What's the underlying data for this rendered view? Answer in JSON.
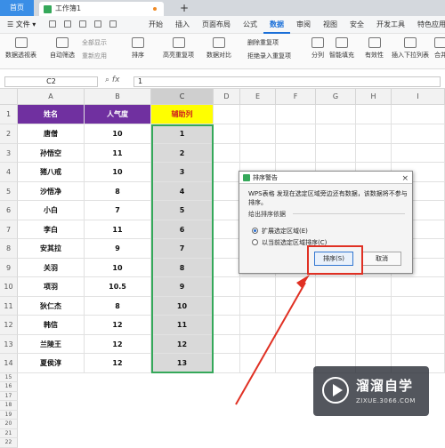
{
  "tabs": {
    "home": "首页",
    "file_title": "工作簿1",
    "add": "+"
  },
  "menubar": {
    "file_label": "文件",
    "items": [
      "开始",
      "插入",
      "页面布局",
      "公式",
      "数据",
      "审阅",
      "视图",
      "安全",
      "开发工具",
      "特色应用"
    ],
    "active": "数据"
  },
  "ribbon": {
    "pivot": "数据透视表",
    "autofilter": "自动筛选",
    "show_all": "全部显示",
    "reapply": "重新应用",
    "sort": "排序",
    "highlight_dup": "高亮重复项",
    "data_compare": "数据对比",
    "remove_dup": "删除重复项",
    "reject_dup": "拒绝录入重复项",
    "split": "分列",
    "smart_fill": "智能填充",
    "validity": "有效性",
    "insert_dropdown": "插入下拉列表",
    "more": "合并"
  },
  "formula_bar": {
    "name_box": "C2",
    "fx": "fx",
    "value": "1"
  },
  "columns": [
    "A",
    "B",
    "C",
    "D",
    "E",
    "F",
    "G",
    "H",
    "I"
  ],
  "selected_column": "C",
  "sheet": {
    "headers": [
      "姓名",
      "人气度",
      "辅助列"
    ],
    "rows": [
      [
        "唐僧",
        "10",
        "1"
      ],
      [
        "孙悟空",
        "11",
        "2"
      ],
      [
        "猪八戒",
        "10",
        "3"
      ],
      [
        "沙悟净",
        "8",
        "4"
      ],
      [
        "小白",
        "7",
        "5"
      ],
      [
        "李白",
        "11",
        "6"
      ],
      [
        "安其拉",
        "9",
        "7"
      ],
      [
        "关羽",
        "10",
        "8"
      ],
      [
        "项羽",
        "10.5",
        "9"
      ],
      [
        "狄仁杰",
        "8",
        "10"
      ],
      [
        "韩信",
        "12",
        "11"
      ],
      [
        "兰陵王",
        "12",
        "12"
      ],
      [
        "夏侯淳",
        "12",
        "13"
      ]
    ],
    "row_numbers": [
      "1",
      "2",
      "3",
      "4",
      "5",
      "6",
      "7",
      "8",
      "9",
      "10",
      "11",
      "12",
      "13",
      "14",
      "15",
      "16",
      "17",
      "18",
      "19",
      "20",
      "21",
      "22"
    ]
  },
  "colors": {
    "header_purple": "#7030a0",
    "header_yellow": "#ffff00",
    "header_red_text": "#d0241b",
    "helper_fill": "#d9d9d9",
    "selection_green": "#35a85a",
    "annotation_red": "#e03023"
  },
  "dialog": {
    "title": "排序警告",
    "close": "×",
    "message": "WPS表格 发现在选定区域旁边还有数据，该数据将不参与排序。",
    "group_label": "给出排序依据",
    "option_expand": "扩展选定区域(E)",
    "option_current": "以当前选定区域排序(C)",
    "selected_option": "expand",
    "sort_button": "排序(S)",
    "cancel_button": "取消"
  },
  "watermark": {
    "name": "溜溜自学",
    "url": "ZIXUE.3066.COM"
  }
}
